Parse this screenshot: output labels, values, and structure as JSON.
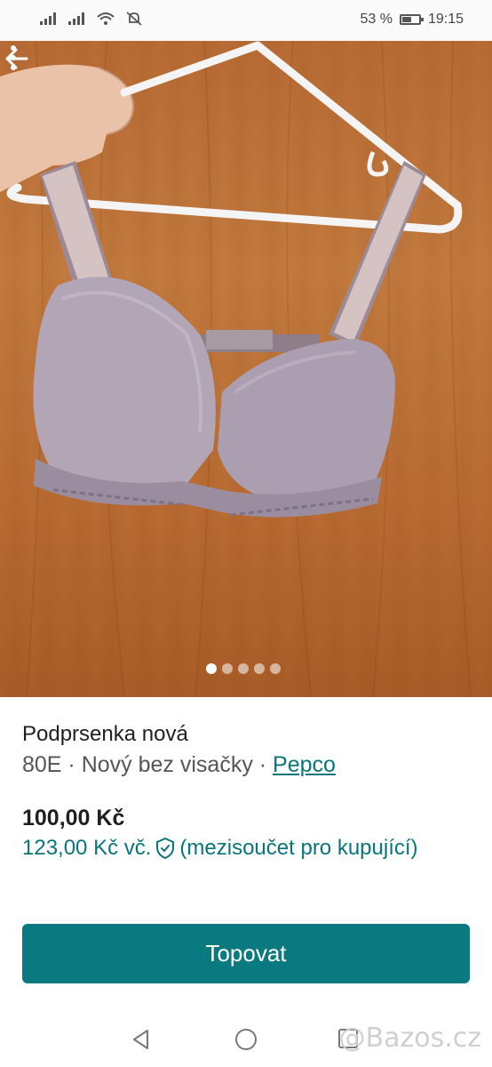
{
  "status_bar": {
    "battery_percent": "53 %",
    "time": "19:15"
  },
  "photo": {
    "page_count": 5,
    "active_page": 1
  },
  "listing": {
    "title": "Podprsenka nová",
    "meta_prefix": "80E · Nový bez visačky · ",
    "brand": "Pepco",
    "price": "100,00 Kč",
    "buyer_price": "123,00 Kč vč.",
    "buyer_note": "(mezisoučet pro kupující)"
  },
  "actions": {
    "bump_label": "Topovat"
  },
  "watermark": "@Bazos.cz",
  "colors": {
    "accent": "#0a7a80",
    "accent_text": "#09757a"
  }
}
